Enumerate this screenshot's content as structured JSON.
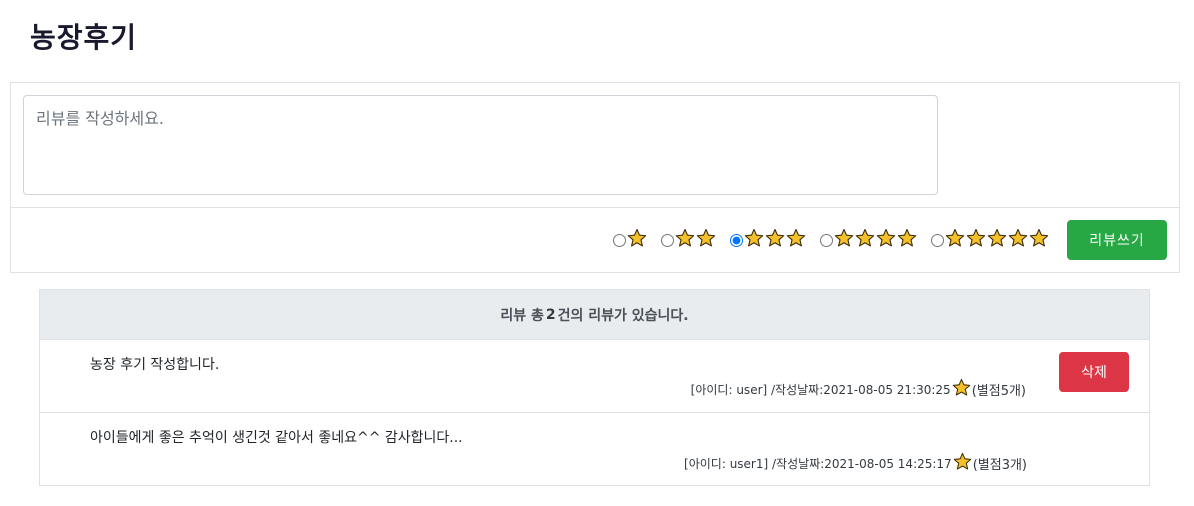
{
  "page": {
    "title": "농장후기"
  },
  "form": {
    "placeholder": "리뷰를 작성하세요.",
    "rating_options": [
      {
        "stars": 1,
        "selected": false
      },
      {
        "stars": 2,
        "selected": false
      },
      {
        "stars": 3,
        "selected": true
      },
      {
        "stars": 4,
        "selected": false
      },
      {
        "stars": 5,
        "selected": false
      }
    ],
    "submit_label": "리뷰쓰기"
  },
  "list": {
    "header_prefix": "리뷰 총",
    "header_count": "2",
    "header_suffix": "건의 리뷰가 있습니다.",
    "reviews": [
      {
        "content": "농장 후기 작성합니다.",
        "meta": "[아이디: user] /작성날짜:2021-08-05 21:30:25",
        "rating_text": "(별점5개)",
        "delete_label": "삭제"
      },
      {
        "content": "아이들에게 좋은 추억이 생긴것 같아서 좋네요^^ 감사합니다...",
        "meta": "[아이디: user1] /작성날짜:2021-08-05 14:25:17",
        "rating_text": "(별점3개)"
      }
    ]
  },
  "colors": {
    "star_fill": "#f5c02a",
    "star_stroke": "#3a2a05",
    "submit": "#28a745",
    "delete": "#dc3545",
    "header_bg": "#e9ecef"
  },
  "icons": {
    "star": "star-icon"
  }
}
